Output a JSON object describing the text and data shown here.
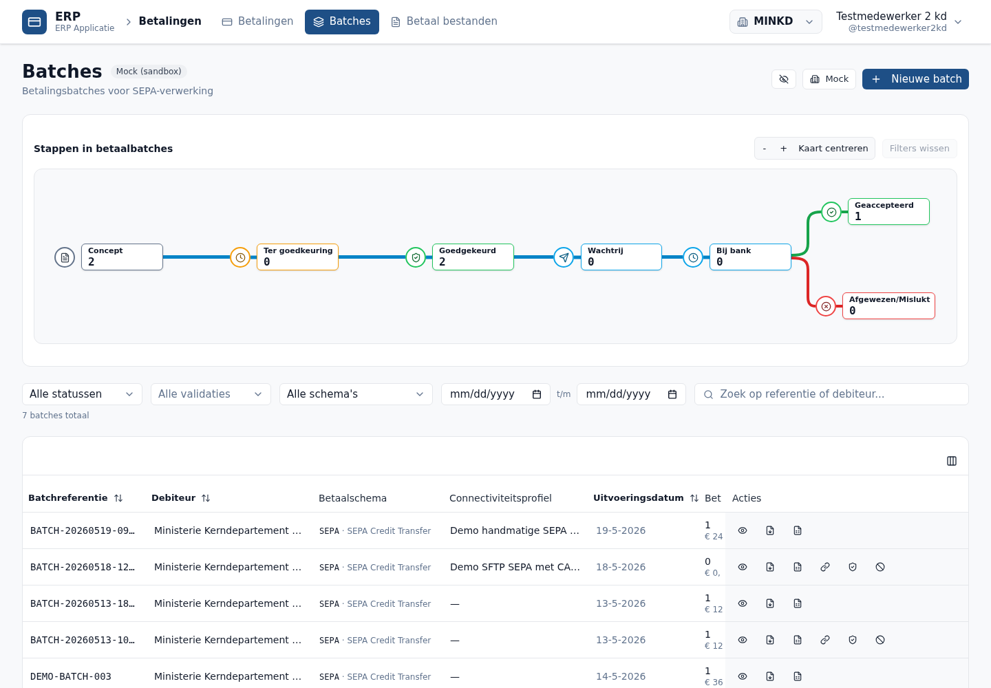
{
  "header": {
    "app_name": "ERP",
    "app_subtitle": "ERP Applicatie",
    "breadcrumb": "Betalingen",
    "nav": [
      {
        "label": "Betalingen",
        "selected": false
      },
      {
        "label": "Batches",
        "selected": true
      },
      {
        "label": "Betaal bestanden",
        "selected": false
      }
    ],
    "org_switcher": "MINKD",
    "user": {
      "name": "Testmedewerker 2 kd",
      "handle": "@testmedewerker2kd"
    }
  },
  "page": {
    "title": "Batches",
    "badge": "Mock (sandbox)",
    "subtitle": "Betalingsbatches voor SEPA-verwerking",
    "mock_button": "Mock",
    "new_button": "Nieuwe batch"
  },
  "flow": {
    "title": "Stappen in betaalbatches",
    "zoom_out": "-",
    "zoom_in": "+",
    "center_button": "Kaart centreren",
    "clear_filters": {
      "label": "Filters wissen",
      "disabled": true
    },
    "stages": [
      {
        "label": "Concept",
        "count": "2",
        "color": "#64748b"
      },
      {
        "label": "Ter goedkeuring",
        "count": "0",
        "color": "#f59e0b"
      },
      {
        "label": "Goedgekeurd",
        "count": "2",
        "color": "#22c55e"
      },
      {
        "label": "Wachtrij",
        "count": "0",
        "color": "#0ea5e9"
      },
      {
        "label": "Bij bank",
        "count": "0",
        "color": "#0ea5e9"
      },
      {
        "label": "Geaccepteerd",
        "count": "1",
        "color": "#22c55e"
      },
      {
        "label": "Afgewezen/Mislukt",
        "count": "0",
        "color": "#ef4444"
      }
    ]
  },
  "filters": [
    {
      "kind": "select",
      "value": "Alle statussen"
    },
    {
      "kind": "select",
      "placeholder": "Alle validaties"
    },
    {
      "kind": "select",
      "value": "Alle schema's"
    },
    {
      "kind": "date",
      "placeholder": "mm/dd/yyyy"
    },
    {
      "kind": "separator",
      "label": "t/m"
    },
    {
      "kind": "date",
      "placeholder": "mm/dd/yyyy"
    },
    {
      "kind": "search",
      "placeholder": "Zoek op referentie of debiteur..."
    }
  ],
  "total": "7 batches totaal",
  "table": {
    "columns": [
      {
        "label": "Batchreferentie",
        "sortable": true
      },
      {
        "label": "Debiteur",
        "sortable": true
      },
      {
        "label": "Betaalschema",
        "sortable": false
      },
      {
        "label": "Connectiviteitsprofiel",
        "sortable": false
      },
      {
        "label": "Uitvoeringsdatum",
        "sortable": true
      },
      {
        "label": "Bet",
        "sortable": false
      },
      {
        "label": "Acties",
        "sortable": false
      }
    ],
    "rows": [
      {
        "reference": "BATCH-20260519-09…",
        "debtor": "Ministerie Kerndepartement …",
        "scheme_code": "SEPA",
        "scheme_separator": "·",
        "scheme_name": "SEPA Credit Transfer",
        "profile": "Demo handmatige SEPA …",
        "date": "19-5-2026",
        "count": "1",
        "amount": "€ 24",
        "actions": [
          {
            "kind": "view"
          },
          {
            "kind": "download"
          },
          {
            "kind": "export"
          }
        ]
      },
      {
        "reference": "BATCH-20260518-12…",
        "debtor": "Ministerie Kerndepartement …",
        "scheme_code": "SEPA",
        "scheme_separator": "·",
        "scheme_name": "SEPA Credit Transfer",
        "profile": "Demo SFTP SEPA met CA…",
        "date": "18-5-2026",
        "count": "0",
        "amount": "€ 0,",
        "actions": [
          {
            "kind": "view"
          },
          {
            "kind": "download"
          },
          {
            "kind": "export"
          },
          {
            "kind": "link"
          },
          {
            "kind": "approve"
          },
          {
            "kind": "cancel"
          }
        ]
      },
      {
        "reference": "BATCH-20260513-18…",
        "debtor": "Ministerie Kerndepartement …",
        "scheme_code": "SEPA",
        "scheme_separator": "·",
        "scheme_name": "SEPA Credit Transfer",
        "profile": "—",
        "date": "13-5-2026",
        "count": "1",
        "amount": "€ 12",
        "actions": [
          {
            "kind": "view"
          },
          {
            "kind": "download"
          },
          {
            "kind": "export"
          }
        ]
      },
      {
        "reference": "BATCH-20260513-10…",
        "debtor": "Ministerie Kerndepartement …",
        "scheme_code": "SEPA",
        "scheme_separator": "·",
        "scheme_name": "SEPA Credit Transfer",
        "profile": "—",
        "date": "13-5-2026",
        "count": "1",
        "amount": "€ 12",
        "actions": [
          {
            "kind": "view"
          },
          {
            "kind": "download"
          },
          {
            "kind": "export"
          },
          {
            "kind": "link"
          },
          {
            "kind": "approve"
          },
          {
            "kind": "cancel"
          }
        ]
      },
      {
        "reference": "DEMO-BATCH-003",
        "debtor": "Ministerie Kerndepartement …",
        "scheme_code": "SEPA",
        "scheme_separator": "·",
        "scheme_name": "SEPA Credit Transfer",
        "profile": "—",
        "date": "14-5-2026",
        "count": "1",
        "amount": "€ 36",
        "actions": [
          {
            "kind": "view"
          },
          {
            "kind": "download"
          },
          {
            "kind": "export"
          }
        ]
      }
    ]
  }
}
